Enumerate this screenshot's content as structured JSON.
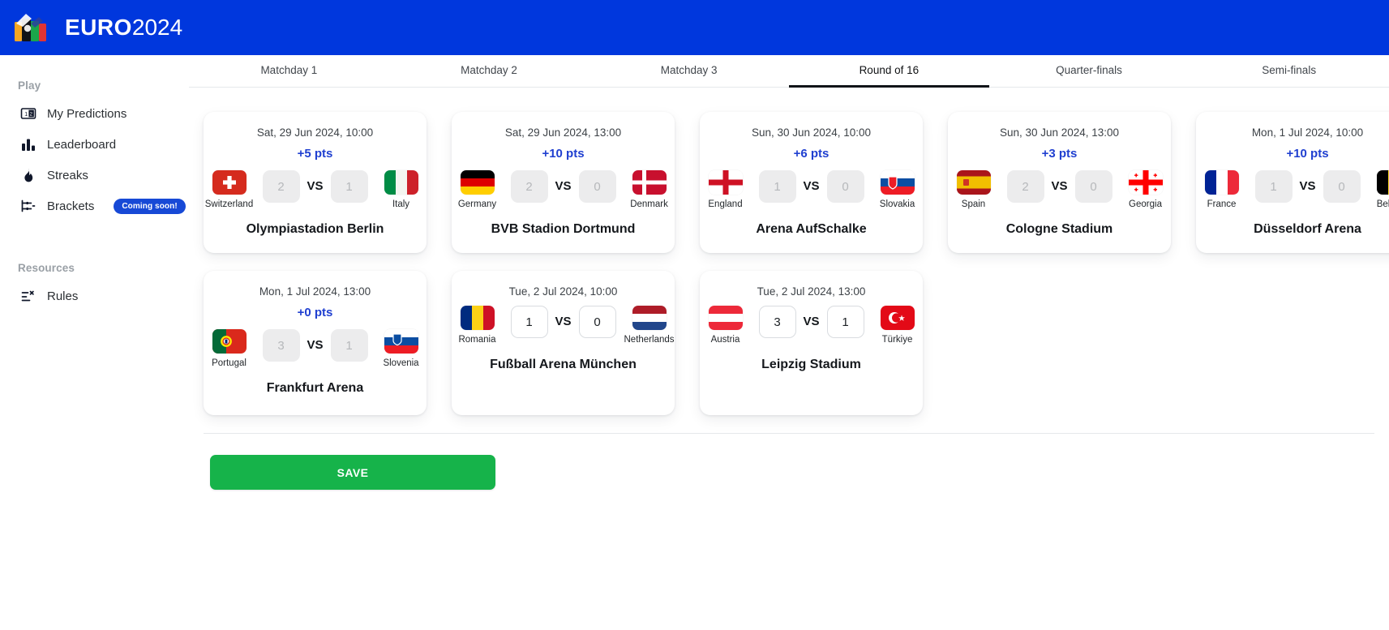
{
  "header": {
    "logo_euro": "EURO",
    "logo_year": "2024",
    "brand_color": "#0037dd"
  },
  "sidebar": {
    "sections": [
      {
        "label": "Play",
        "items": [
          {
            "label": "My Predictions",
            "icon": "predictions-icon",
            "badge": null
          },
          {
            "label": "Leaderboard",
            "icon": "bar-chart-icon",
            "badge": null
          },
          {
            "label": "Streaks",
            "icon": "flame-icon",
            "badge": null
          },
          {
            "label": "Brackets",
            "icon": "bracket-icon",
            "badge": "Coming soon!"
          }
        ]
      },
      {
        "label": "Resources",
        "items": [
          {
            "label": "Rules",
            "icon": "rules-icon",
            "badge": null
          }
        ]
      }
    ]
  },
  "tabs": [
    {
      "label": "Matchday 1",
      "active": false
    },
    {
      "label": "Matchday 2",
      "active": false
    },
    {
      "label": "Matchday 3",
      "active": false
    },
    {
      "label": "Round of 16",
      "active": true
    },
    {
      "label": "Quarter-finals",
      "active": false
    },
    {
      "label": "Semi-finals",
      "active": false
    }
  ],
  "matches_row1": [
    {
      "date": "Sat, 29 Jun 2024, 10:00",
      "points": "+5 pts",
      "home": {
        "name": "Switzerland",
        "flag": "switzerland",
        "score": "2"
      },
      "away": {
        "name": "Italy",
        "flag": "italy",
        "score": "1"
      },
      "vs": "VS",
      "venue": "Olympiastadion Berlin",
      "locked": true
    },
    {
      "date": "Sat, 29 Jun 2024, 13:00",
      "points": "+10 pts",
      "home": {
        "name": "Germany",
        "flag": "germany",
        "score": "2"
      },
      "away": {
        "name": "Denmark",
        "flag": "denmark",
        "score": "0"
      },
      "vs": "VS",
      "venue": "BVB Stadion Dortmund",
      "locked": true
    },
    {
      "date": "Sun, 30 Jun 2024, 10:00",
      "points": "+6 pts",
      "home": {
        "name": "England",
        "flag": "england",
        "score": "1"
      },
      "away": {
        "name": "Slovakia",
        "flag": "slovakia",
        "score": "0"
      },
      "vs": "VS",
      "venue": "Arena AufSchalke",
      "locked": true
    },
    {
      "date": "Sun, 30 Jun 2024, 13:00",
      "points": "+3 pts",
      "home": {
        "name": "Spain",
        "flag": "spain",
        "score": "2"
      },
      "away": {
        "name": "Georgia",
        "flag": "georgia",
        "score": "0"
      },
      "vs": "VS",
      "venue": "Cologne Stadium",
      "locked": true
    },
    {
      "date": "Mon, 1 Jul 2024, 10:00",
      "points": "+10 pts",
      "home": {
        "name": "France",
        "flag": "france",
        "score": "1"
      },
      "away": {
        "name": "Belgium",
        "flag": "belgium",
        "score": "0"
      },
      "vs": "VS",
      "venue": "Düsseldorf Arena",
      "locked": true
    }
  ],
  "matches_row2": [
    {
      "date": "Mon, 1 Jul 2024, 13:00",
      "points": "+0 pts",
      "home": {
        "name": "Portugal",
        "flag": "portugal",
        "score": "3"
      },
      "away": {
        "name": "Slovenia",
        "flag": "slovenia",
        "score": "1"
      },
      "vs": "VS",
      "venue": "Frankfurt Arena",
      "locked": true
    },
    {
      "date": "Tue, 2 Jul 2024, 10:00",
      "points": null,
      "home": {
        "name": "Romania",
        "flag": "romania",
        "score": "1"
      },
      "away": {
        "name": "Netherlands",
        "flag": "netherlands",
        "score": "0"
      },
      "vs": "VS",
      "venue": "Fußball Arena München",
      "locked": false
    },
    {
      "date": "Tue, 2 Jul 2024, 13:00",
      "points": null,
      "home": {
        "name": "Austria",
        "flag": "austria",
        "score": "3"
      },
      "away": {
        "name": "Türkiye",
        "flag": "turkiye",
        "score": "1"
      },
      "vs": "VS",
      "venue": "Leipzig Stadium",
      "locked": false
    }
  ],
  "footer": {
    "save_label": "SAVE",
    "save_color": "#16b34a"
  }
}
